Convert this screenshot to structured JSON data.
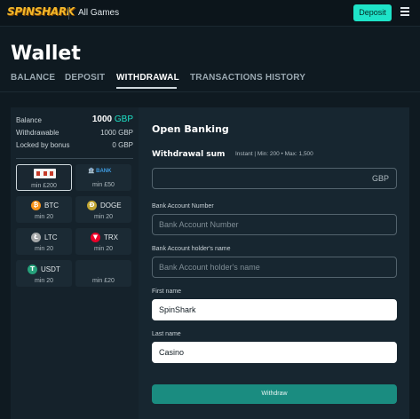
{
  "header": {
    "logo": "SPINSHARK",
    "all_games": "All Games",
    "deposit": "Deposit"
  },
  "page": {
    "title": "Wallet",
    "tabs": [
      {
        "label": "BALANCE",
        "active": false
      },
      {
        "label": "DEPOSIT",
        "active": false
      },
      {
        "label": "WITHDRAWAL",
        "active": true
      },
      {
        "label": "TRANSACTIONS HISTORY",
        "active": false
      }
    ]
  },
  "balance": {
    "balance_label": "Balance",
    "balance_value": "1000",
    "balance_currency": "GBP",
    "withdrawable_label": "Withdrawable",
    "withdrawable_value": "1000 GBP",
    "locked_label": "Locked by bonus",
    "locked_value": "0 GBP"
  },
  "methods": [
    {
      "name": "",
      "min": "min £200",
      "icon": "open-banking-logo",
      "selected": true
    },
    {
      "name": "",
      "min": "min £50",
      "icon": "bank-transfer-logo",
      "selected": false
    },
    {
      "name": "BTC",
      "min": "min 20",
      "icon": "btc-icon",
      "color": "#f7931a",
      "selected": false
    },
    {
      "name": "DOGE",
      "min": "min 20",
      "icon": "doge-icon",
      "color": "#c2a633",
      "selected": false
    },
    {
      "name": "LTC",
      "min": "min 20",
      "icon": "ltc-icon",
      "color": "#a6a9aa",
      "selected": false
    },
    {
      "name": "TRX",
      "min": "min 20",
      "icon": "trx-icon",
      "color": "#eb0029",
      "selected": false
    },
    {
      "name": "USDT",
      "min": "min 20",
      "icon": "usdt-icon",
      "color": "#26a17b",
      "selected": false
    },
    {
      "name": "",
      "min": "min £20",
      "icon": "blank",
      "selected": false
    }
  ],
  "form": {
    "section_title": "Open Banking",
    "withdrawal_title": "Withdrawal sum",
    "withdrawal_note": "Instant | Min: 200 • Max: 1,500",
    "currency_suffix": "GBP",
    "account_number_label": "Bank Account Number",
    "account_number_placeholder": "Bank Account Number",
    "holder_label": "Bank Account holder's name",
    "holder_placeholder": "Bank Account holder's name",
    "first_name_label": "First name",
    "first_name_value": "SpinShark",
    "last_name_label": "Last name",
    "last_name_value": "Casino",
    "submit": "Withdraw"
  },
  "colors": {
    "accent": "#1ee3c8",
    "button": "#1a8c80",
    "background": "#0f1a21"
  }
}
